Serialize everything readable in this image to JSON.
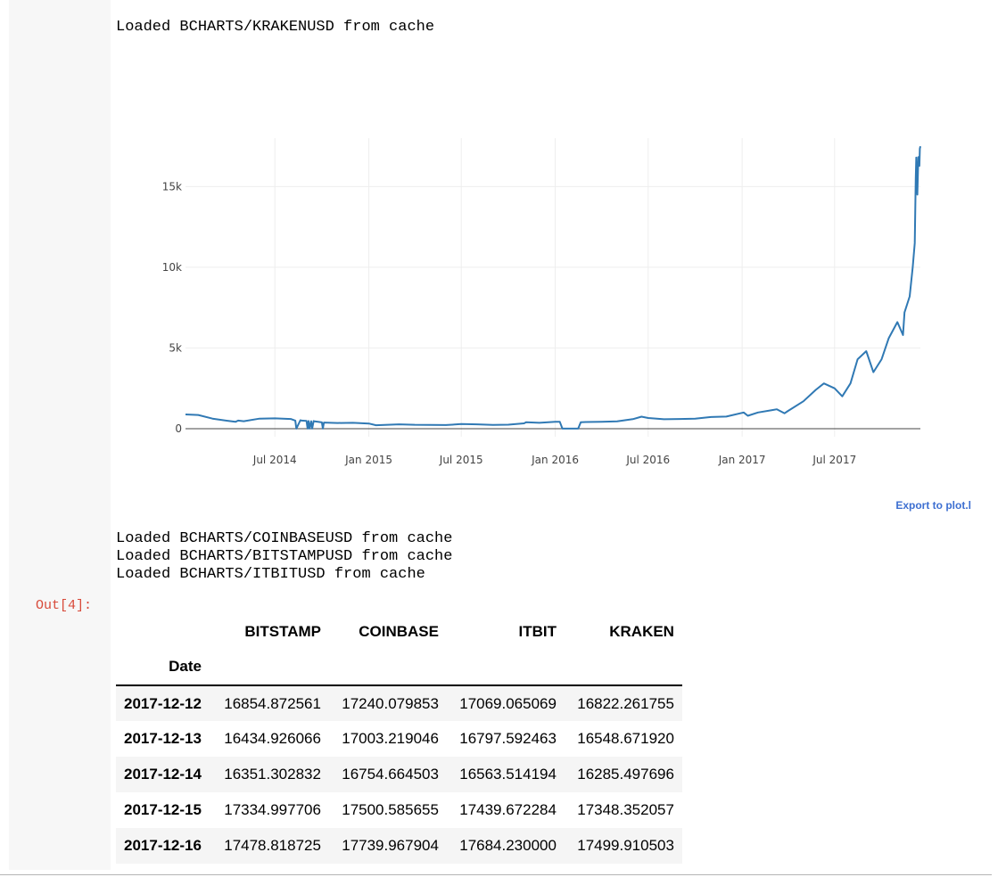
{
  "notebook": {
    "log_lines_top": [
      "Loaded BCHARTS/KRAKENUSD from cache"
    ],
    "log_lines_bottom": [
      "Loaded BCHARTS/COINBASEUSD from cache",
      "Loaded BCHARTS/BITSTAMPUSD from cache",
      "Loaded BCHARTS/ITBITUSD from cache"
    ],
    "out_prompt": "Out[4]:",
    "export_link": "Export to plot.l"
  },
  "chart_data": {
    "type": "line",
    "x_tick_labels": [
      "Jul 2014",
      "Jan 2015",
      "Jul 2015",
      "Jan 2016",
      "Jul 2016",
      "Jan 2017",
      "Jul 2017"
    ],
    "y_ticks": [
      0,
      5000,
      10000,
      15000
    ],
    "y_tick_labels": [
      "0",
      "5k",
      "10k",
      "15k"
    ],
    "x_range": [
      "2014-01-07",
      "2017-12-16"
    ],
    "y_range": [
      -500,
      18000
    ],
    "grid": true,
    "line_color": "#3079b4",
    "series": [
      {
        "x": [
          "2014-01-07",
          "2014-02-01",
          "2014-03-01",
          "2014-04-01",
          "2014-04-15",
          "2014-04-20",
          "2014-05-01",
          "2014-06-01",
          "2014-07-01",
          "2014-08-01",
          "2014-08-10",
          "2014-08-12",
          "2014-08-20",
          "2014-08-22",
          "2014-09-01",
          "2014-09-03",
          "2014-09-05",
          "2014-09-07",
          "2014-09-10",
          "2014-09-12",
          "2014-09-15",
          "2014-09-17",
          "2014-10-01",
          "2014-10-03",
          "2014-10-05",
          "2014-11-01",
          "2014-12-01",
          "2015-01-01",
          "2015-01-15",
          "2015-02-01",
          "2015-03-01",
          "2015-04-01",
          "2015-05-01",
          "2015-06-01",
          "2015-07-01",
          "2015-08-01",
          "2015-09-01",
          "2015-10-01",
          "2015-11-01",
          "2015-11-05",
          "2015-12-01",
          "2016-01-01",
          "2016-01-10",
          "2016-01-15",
          "2016-02-15",
          "2016-02-20",
          "2016-03-01",
          "2016-04-01",
          "2016-05-01",
          "2016-06-01",
          "2016-06-18",
          "2016-07-01",
          "2016-08-01",
          "2016-09-01",
          "2016-10-01",
          "2016-11-01",
          "2016-12-01",
          "2017-01-04",
          "2017-01-12",
          "2017-02-01",
          "2017-03-01",
          "2017-03-10",
          "2017-03-25",
          "2017-04-01",
          "2017-05-01",
          "2017-05-25",
          "2017-06-10",
          "2017-07-01",
          "2017-07-16",
          "2017-08-01",
          "2017-08-15",
          "2017-09-01",
          "2017-09-15",
          "2017-10-01",
          "2017-10-15",
          "2017-11-01",
          "2017-11-12",
          "2017-11-15",
          "2017-11-25",
          "2017-12-01",
          "2017-12-05",
          "2017-12-07",
          "2017-12-08",
          "2017-12-10",
          "2017-12-12",
          "2017-12-13",
          "2017-12-14",
          "2017-12-15",
          "2017-12-16"
        ],
        "y": [
          880,
          850,
          620,
          480,
          420,
          500,
          460,
          620,
          640,
          600,
          500,
          0,
          520,
          500,
          480,
          0,
          470,
          0,
          460,
          0,
          470,
          450,
          390,
          0,
          380,
          350,
          360,
          320,
          210,
          230,
          270,
          240,
          235,
          225,
          285,
          270,
          230,
          245,
          330,
          400,
          360,
          430,
          420,
          0,
          0,
          400,
          410,
          425,
          450,
          590,
          740,
          660,
          580,
          600,
          620,
          720,
          750,
          1000,
          800,
          1000,
          1150,
          1200,
          950,
          1100,
          1700,
          2400,
          2800,
          2500,
          2000,
          2800,
          4300,
          4800,
          3500,
          4300,
          5600,
          6600,
          5800,
          7200,
          8200,
          10000,
          11500,
          15500,
          16800,
          14500,
          16822,
          16549,
          16285,
          17348,
          17500
        ]
      }
    ]
  },
  "table": {
    "columns": [
      "BITSTAMP",
      "COINBASE",
      "ITBIT",
      "KRAKEN"
    ],
    "index_name": "Date",
    "rows": [
      {
        "date": "2017-12-12",
        "values": [
          "16854.872561",
          "17240.079853",
          "17069.065069",
          "16822.261755"
        ]
      },
      {
        "date": "2017-12-13",
        "values": [
          "16434.926066",
          "17003.219046",
          "16797.592463",
          "16548.671920"
        ]
      },
      {
        "date": "2017-12-14",
        "values": [
          "16351.302832",
          "16754.664503",
          "16563.514194",
          "16285.497696"
        ]
      },
      {
        "date": "2017-12-15",
        "values": [
          "17334.997706",
          "17500.585655",
          "17439.672284",
          "17348.352057"
        ]
      },
      {
        "date": "2017-12-16",
        "values": [
          "17478.818725",
          "17739.967904",
          "17684.230000",
          "17499.910503"
        ]
      }
    ]
  }
}
